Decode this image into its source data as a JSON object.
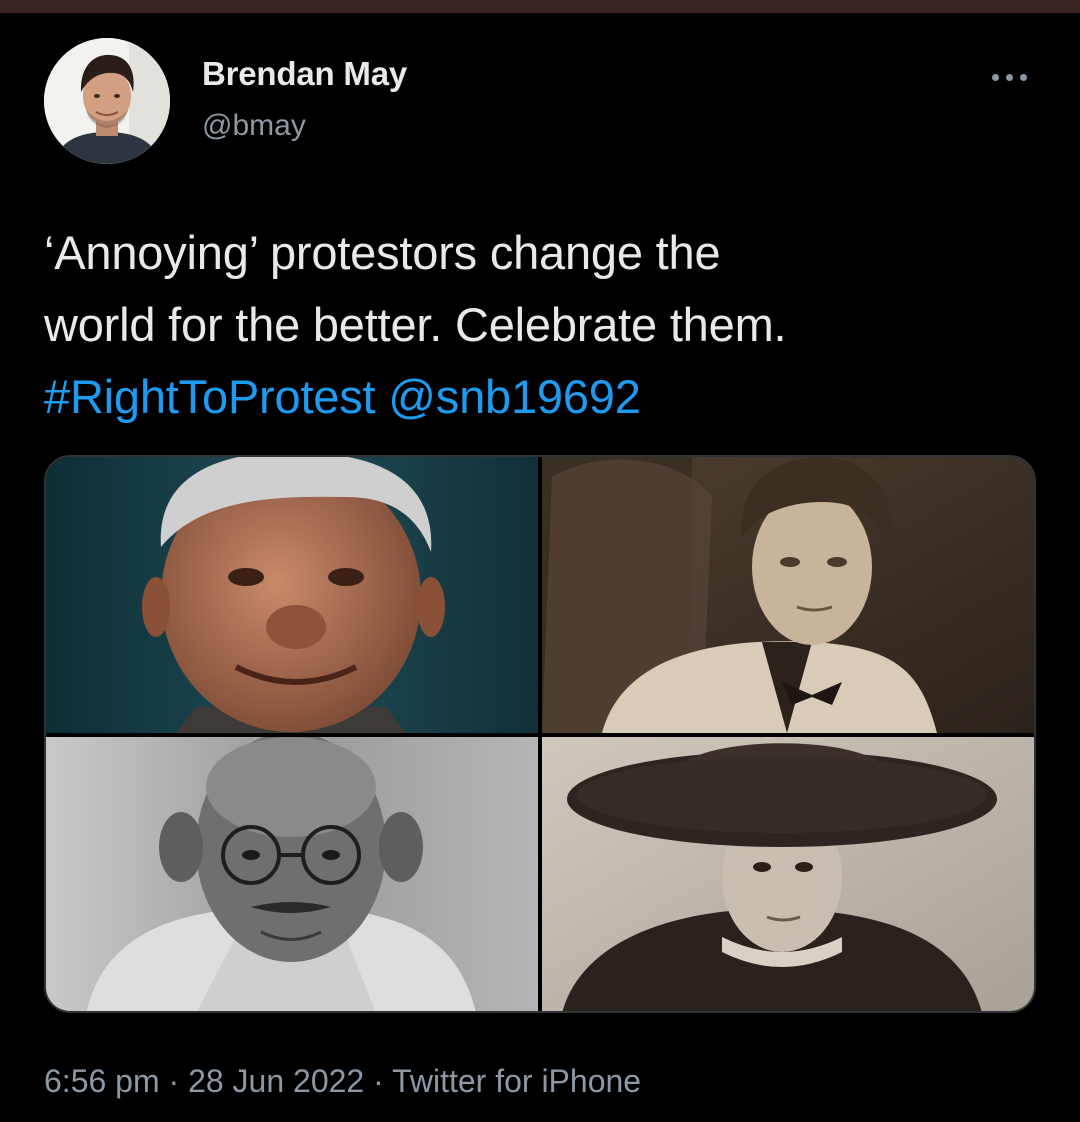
{
  "author": {
    "display_name": "Brendan May",
    "handle": "@bmay",
    "avatar_icon": "profile-photo"
  },
  "menu_icon": "more-dots-icon",
  "tweet": {
    "text_line1": "‘Annoying’ protestors change the",
    "text_line2": "world for the better. Celebrate them.",
    "hashtag": "#RightToProtest",
    "mention": "@snb19692"
  },
  "media": {
    "photos": [
      {
        "name": "photo-man-smiling-color",
        "tone": "#1c4a52"
      },
      {
        "name": "photo-woman-sepia",
        "tone": "#5a4a3a"
      },
      {
        "name": "photo-man-glasses-bw",
        "tone": "#8a8a8a"
      },
      {
        "name": "photo-woman-hat-sepia",
        "tone": "#b8b0a4"
      }
    ]
  },
  "footer": {
    "time": "6:56 pm",
    "separator": " · ",
    "date": "28 Jun 2022",
    "source": "Twitter for iPhone"
  },
  "colors": {
    "background": "#000000",
    "text": "#e7e9ea",
    "muted": "#8b98a5",
    "link": "#1d9bf0",
    "border": "#2f3336"
  }
}
